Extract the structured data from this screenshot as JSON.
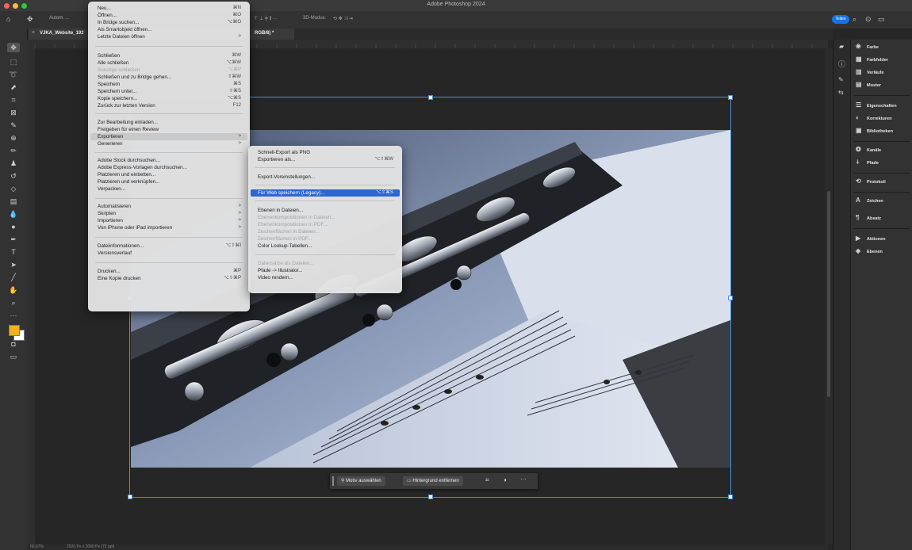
{
  "app": {
    "title": "Adobe Photoshop 2024",
    "document_tab": {
      "name_start": "VJKA_Website_192",
      "name_end": "RGB/8) *"
    },
    "share_label": "Teilen",
    "status_zoom": "66,67%",
    "status_info": "2920 Px x 2060 Px (72 ppi)"
  },
  "options_bar": {
    "autoselect_label": "Autom. ...",
    "mode_label": "3D-Modus:"
  },
  "file_menu": [
    {
      "label": "Neu...",
      "shortcut": "⌘N"
    },
    {
      "label": "Öffnen...",
      "shortcut": "⌘O"
    },
    {
      "label": "In Bridge suchen...",
      "shortcut": "⌥⌘O"
    },
    {
      "label": "Als Smartobjekt öffnen...",
      "shortcut": ""
    },
    {
      "label": "Letzte Dateien öffnen",
      "shortcut": ">"
    },
    {
      "label": "Schließen",
      "shortcut": "⌘W"
    },
    {
      "label": "Alle schließen",
      "shortcut": "⌥⌘W"
    },
    {
      "label": "Sonstige schließen",
      "shortcut": "⌥⌘P"
    },
    {
      "label": "Schließen und zu Bridge gehen...",
      "shortcut": "⇧⌘W"
    },
    {
      "label": "Speichern",
      "shortcut": "⌘S"
    },
    {
      "label": "Speichern unter...",
      "shortcut": "⇧⌘S"
    },
    {
      "label": "Kopie speichern...",
      "shortcut": "⌥⌘S"
    },
    {
      "label": "Zurück zur letzten Version",
      "shortcut": "F12"
    },
    {
      "label": "Zur Bearbeitung einladen...",
      "shortcut": ""
    },
    {
      "label": "Freigeben für einen Review",
      "shortcut": ""
    },
    {
      "label": "Exportieren",
      "shortcut": ">"
    },
    {
      "label": "Generieren",
      "shortcut": ">"
    },
    {
      "label": "Adobe Stock durchsuchen...",
      "shortcut": ""
    },
    {
      "label": "Adobe Express-Vorlagen durchsuchen...",
      "shortcut": ""
    },
    {
      "label": "Platzieren und einbetten...",
      "shortcut": ""
    },
    {
      "label": "Platzieren und verknüpfen...",
      "shortcut": ""
    },
    {
      "label": "Verpacken...",
      "shortcut": ""
    },
    {
      "label": "Automatisieren",
      "shortcut": ">"
    },
    {
      "label": "Skripten",
      "shortcut": ">"
    },
    {
      "label": "Importieren",
      "shortcut": ">"
    },
    {
      "label": "Von iPhone oder iPad importieren",
      "shortcut": ">"
    },
    {
      "label": "Dateiinformationen...",
      "shortcut": "⌥⇧⌘I"
    },
    {
      "label": "Versionsverlauf",
      "shortcut": ""
    },
    {
      "label": "Drucken...",
      "shortcut": "⌘P"
    },
    {
      "label": "Eine Kopie drucken",
      "shortcut": "⌥⇧⌘P"
    }
  ],
  "export_submenu": [
    {
      "label": "Schnell-Export als PNG",
      "shortcut": ""
    },
    {
      "label": "Exportieren als...",
      "shortcut": "⌥⇧⌘W"
    },
    {
      "label": "Export-Voreinstellungen...",
      "shortcut": ""
    },
    {
      "label": "Für Web speichern (Legacy)...",
      "shortcut": "⌥⇧⌘S"
    },
    {
      "label": "Ebenen in Dateien...",
      "shortcut": ""
    },
    {
      "label": "Ebenenkompositionen in Dateien...",
      "shortcut": ""
    },
    {
      "label": "Ebenenkompositionen in PDF...",
      "shortcut": ""
    },
    {
      "label": "Zeichenflächen in Dateien...",
      "shortcut": ""
    },
    {
      "label": "Zeichenflächen in PDF...",
      "shortcut": ""
    },
    {
      "label": "Color Lookup-Tabellen...",
      "shortcut": ""
    },
    {
      "label": "Datensätze als Dateien...",
      "shortcut": ""
    },
    {
      "label": "Pfade -> Illustrator...",
      "shortcut": ""
    },
    {
      "label": "Video rendern...",
      "shortcut": ""
    }
  ],
  "context_bar": {
    "select_subject": "Motiv auswählen",
    "remove_bg": "Hintergrund entfernen",
    "more": "···"
  },
  "panels": [
    {
      "label": "Farbe",
      "icon": "color-wheel-icon"
    },
    {
      "label": "Farbfelder",
      "icon": "swatches-icon"
    },
    {
      "label": "Verläufe",
      "icon": "gradient-icon"
    },
    {
      "label": "Muster",
      "icon": "pattern-icon"
    },
    {
      "label": "Eigenschaften",
      "icon": "properties-icon"
    },
    {
      "label": "Korrekturen",
      "icon": "adjustments-icon"
    },
    {
      "label": "Bibliotheken",
      "icon": "libraries-icon"
    },
    {
      "label": "Kanäle",
      "icon": "channels-icon"
    },
    {
      "label": "Pfade",
      "icon": "paths-icon"
    },
    {
      "label": "Protokoll",
      "icon": "history-icon"
    },
    {
      "label": "Zeichen",
      "icon": "character-icon"
    },
    {
      "label": "Absatz",
      "icon": "paragraph-icon"
    },
    {
      "label": "Aktionen",
      "icon": "actions-icon"
    },
    {
      "label": "Ebenen",
      "icon": "layers-icon"
    }
  ],
  "colors": {
    "accent": "#1473e6",
    "menu_highlight": "#2d65d6",
    "foreground_swatch": "#f3b21b",
    "background_swatch": "#ffffff"
  }
}
